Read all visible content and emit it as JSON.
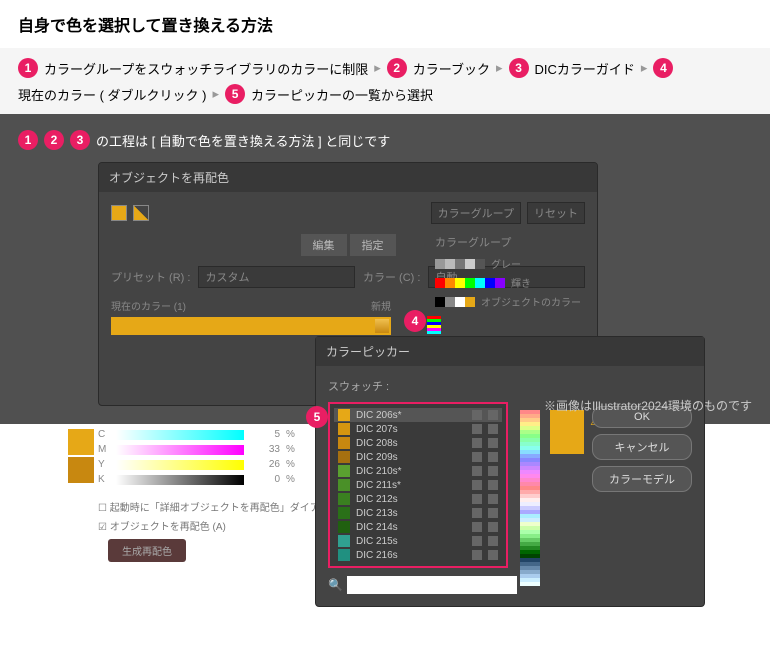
{
  "header": {
    "title": "自身で色を選択して置き換える方法"
  },
  "breadcrumb": {
    "items": [
      {
        "num": "1",
        "text": "カラーグループをスウォッチライブラリのカラーに制限"
      },
      {
        "num": "2",
        "text": "カラーブック"
      },
      {
        "num": "3",
        "text": "DICカラーガイド"
      },
      {
        "num": "4",
        "text": "現在のカラー ( ダブルクリック )"
      },
      {
        "num": "5",
        "text": "カラーピッカーの一覧から選択"
      }
    ]
  },
  "canvas_caption": {
    "nums": [
      "1",
      "2",
      "3"
    ],
    "text": "の工程は [ 自動で色を置き換える方法 ] と同じです"
  },
  "dialog1": {
    "title": "オブジェクトを再配色",
    "colorgroup_select": "カラーグループ",
    "reset": "リセット",
    "tabs": [
      "編集",
      "指定"
    ],
    "preset_label": "プリセット (R) :",
    "preset_value": "カスタム",
    "color_label": "カラー (C) :",
    "color_value": "自動",
    "current_label": "現在のカラー (1)",
    "new_label": "新規",
    "colorgroup_title": "カラーグループ",
    "cg_rows": [
      {
        "label": "グレー",
        "colors": [
          "#999",
          "#bbb",
          "#777",
          "#ccc",
          "#555"
        ]
      },
      {
        "label": "輝き",
        "colors": [
          "#f00",
          "#f80",
          "#ff0",
          "#0f0",
          "#0ff",
          "#00f",
          "#80f"
        ]
      },
      {
        "label": "オブジェクトのカラー",
        "colors": [
          "#000",
          "#888",
          "#fff",
          "#e6a817"
        ]
      }
    ],
    "checks": [
      "起動時に「詳細オブジェクトを再配色」ダイアログを開く",
      "オブジェクトを再配色 (A)"
    ],
    "gen_btn": "生成再配色",
    "sliders": {
      "labels": [
        "C",
        "M",
        "Y",
        "K"
      ],
      "values": [
        "5",
        "33",
        "26",
        "0"
      ]
    }
  },
  "dialog2": {
    "title": "カラーピッカー",
    "swatch_label": "スウォッチ :",
    "items": [
      {
        "name": "DIC 206s*",
        "color": "#e6a817",
        "sel": true
      },
      {
        "name": "DIC 207s",
        "color": "#d49510"
      },
      {
        "name": "DIC 208s",
        "color": "#c88810"
      },
      {
        "name": "DIC 209s",
        "color": "#a67010"
      },
      {
        "name": "DIC 210s*",
        "color": "#5aa030"
      },
      {
        "name": "DIC 211s*",
        "color": "#4a9028"
      },
      {
        "name": "DIC 212s",
        "color": "#3a8020"
      },
      {
        "name": "DIC 213s",
        "color": "#2a7018"
      },
      {
        "name": "DIC 214s",
        "color": "#206010"
      },
      {
        "name": "DIC 215s",
        "color": "#30a090"
      },
      {
        "name": "DIC 216s",
        "color": "#209080"
      }
    ],
    "buttons": {
      "ok": "OK",
      "cancel": "キャンセル",
      "colormodel": "カラーモデル"
    },
    "search_placeholder": ""
  },
  "footer": "※画像はIllustrator2024環境のものです"
}
